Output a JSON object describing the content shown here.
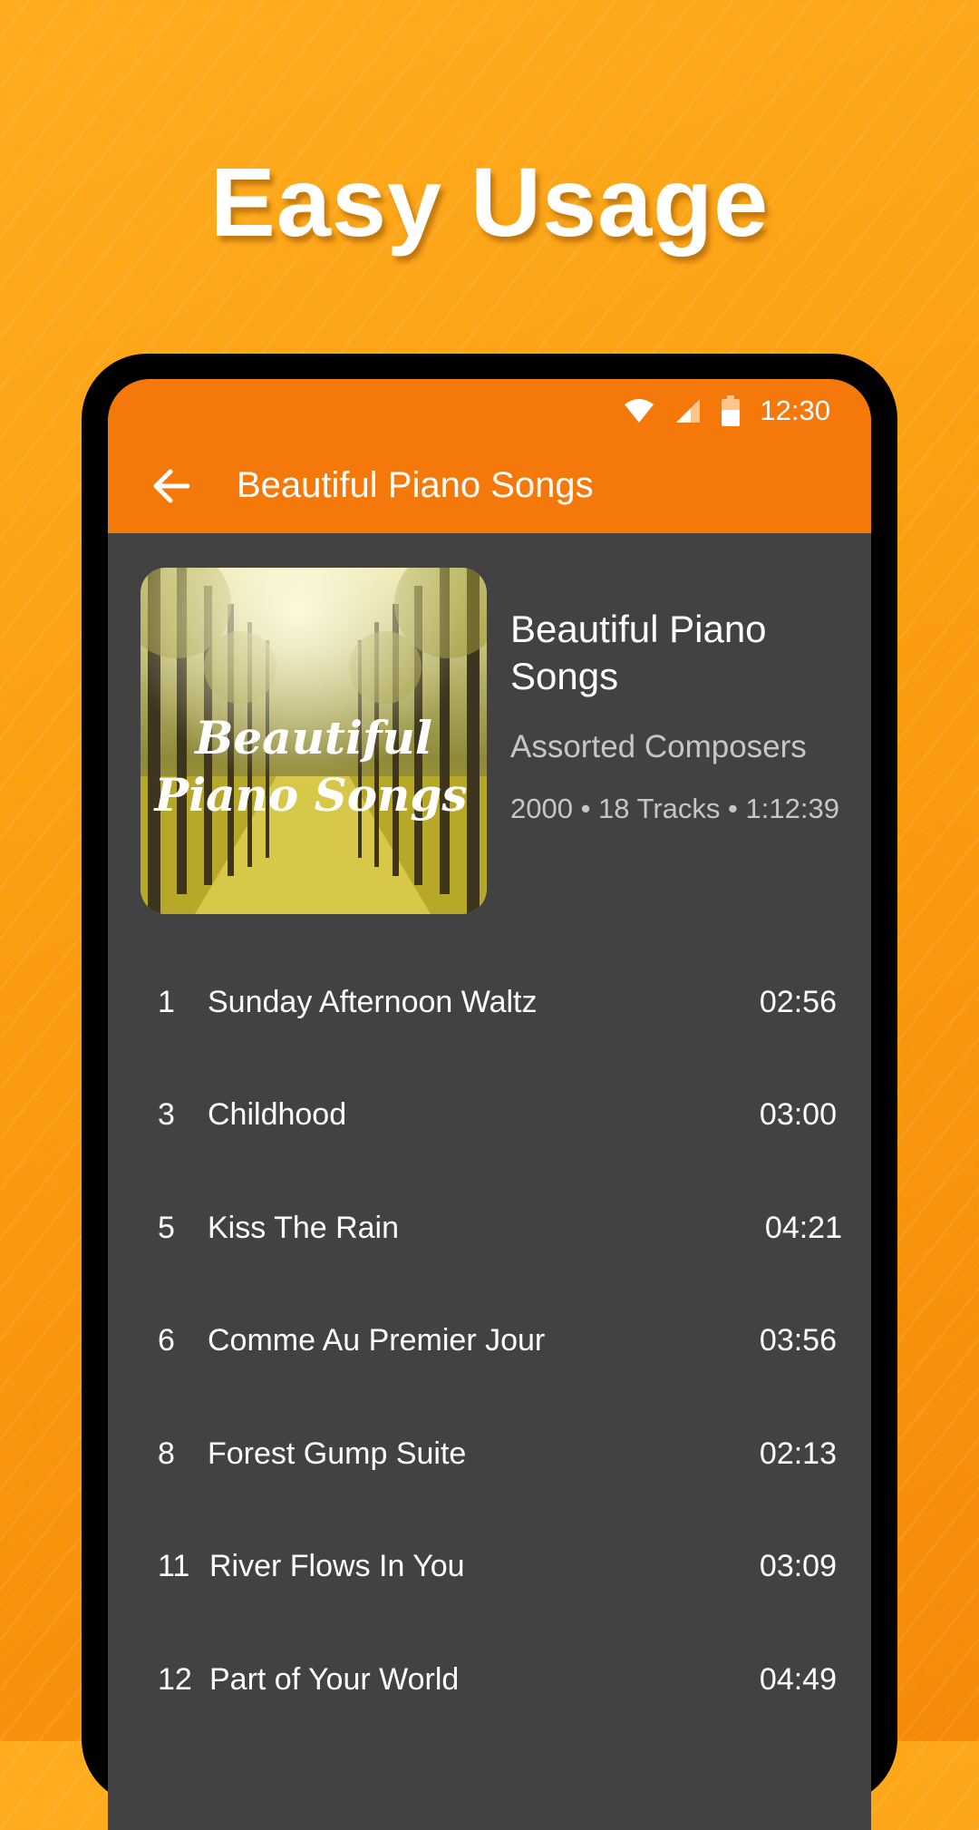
{
  "headline": "Easy Usage",
  "status_bar": {
    "time": "12:30",
    "icons": [
      "wifi-icon",
      "cell-signal-icon",
      "battery-icon"
    ]
  },
  "toolbar": {
    "back_icon": "arrow-left-icon",
    "title": "Beautiful Piano Songs"
  },
  "album": {
    "cover_text_line1": "Beautiful",
    "cover_text_line2": "Piano Songs",
    "title": "Beautiful Piano Songs",
    "artist": "Assorted Composers",
    "meta": "2000 • 18 Tracks • 1:12:39"
  },
  "tracks": [
    {
      "number": "1",
      "title": "Sunday Afternoon Waltz",
      "duration": "02:56"
    },
    {
      "number": "3",
      "title": "Childhood",
      "duration": "03:00"
    },
    {
      "number": "5",
      "title": "Kiss The Rain",
      "duration": "04:21"
    },
    {
      "number": "6",
      "title": "Comme Au Premier Jour",
      "duration": "03:56"
    },
    {
      "number": "8",
      "title": "Forest Gump Suite",
      "duration": "02:13"
    },
    {
      "number": "11",
      "title": "River Flows In You",
      "duration": "03:09"
    },
    {
      "number": "12",
      "title": "Part of Your World",
      "duration": "04:49"
    }
  ],
  "colors": {
    "accent": "#f5790a",
    "list_background": "#424242",
    "background_orange": "#fb9d10"
  }
}
